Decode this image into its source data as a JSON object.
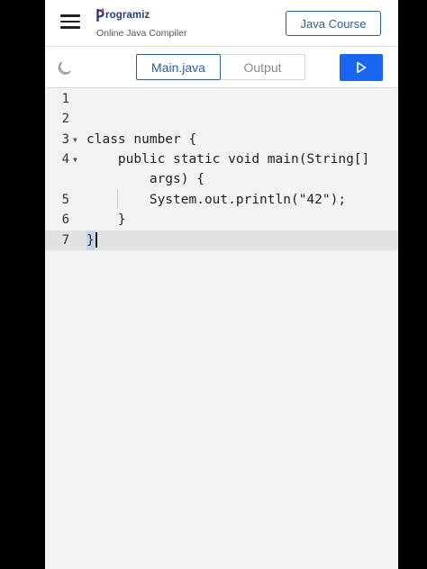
{
  "header": {
    "brand": "rogramiz",
    "subtitle": "Online Java Compiler",
    "course_button": "Java Course"
  },
  "toolbar": {
    "tabs": [
      {
        "label": "Main.java",
        "active": true
      },
      {
        "label": "Output",
        "active": false
      }
    ],
    "run_icon": "play-icon",
    "theme_icon": "moon-icon"
  },
  "editor": {
    "line_numbers": [
      "1",
      "2",
      "3",
      "4",
      "",
      "5",
      "6",
      "7"
    ],
    "lines": [
      "",
      "",
      "class number {",
      "    public static void main(String[]",
      "        args) {",
      "        System.out.println(\"42\");",
      "    }",
      "}"
    ],
    "active_line": "7"
  },
  "colors": {
    "brand_blue": "#2c5f8f",
    "run_button": "#1a66f2",
    "editor_bg": "#f3f3f3",
    "active_line": "#e2e2e2"
  }
}
